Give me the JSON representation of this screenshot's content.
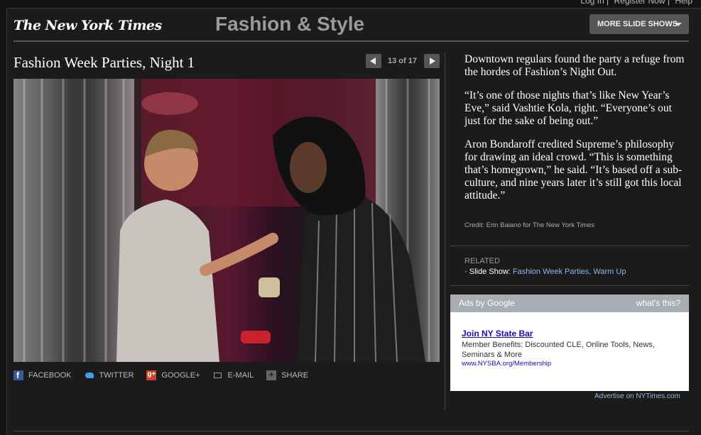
{
  "top_links": {
    "login": "Log In",
    "register": "Register Now",
    "help": "Help"
  },
  "header": {
    "logo": "The New York Times",
    "section": "Fashion & Style",
    "more_button": "MORE SLIDE SHOWS"
  },
  "slideshow": {
    "title": "Fashion Week Parties, Night 1",
    "counter": "13 of 17",
    "photo_alt": "Party guests talking at Fashion Week event"
  },
  "share": [
    {
      "label": "FACEBOOK",
      "icon": "facebook-icon"
    },
    {
      "label": "TWITTER",
      "icon": "twitter-icon"
    },
    {
      "label": "GOOGLE+",
      "icon": "google-plus-icon"
    },
    {
      "label": "E-MAIL",
      "icon": "email-icon"
    },
    {
      "label": "SHARE",
      "icon": "share-icon"
    }
  ],
  "caption": {
    "p1": "Downtown regulars found the party a refuge from the hordes of Fashion’s Night Out.",
    "p2": "“It’s one of those nights that’s like New Year’s Eve,” said Vashtie Kola, right. “Everyone’s out just for the sake of being out.”",
    "p3": "Aron Bondaroff credited Supreme’s philosophy for drawing an ideal crowd. “This is something that’s homegrown,” he said. “It’s based off a sub-culture, and nine years later it’s still got this local attitude.”",
    "credit": "Credit: Erin Baiano for The New York Times"
  },
  "related": {
    "label": "RELATED",
    "prefix": "Slide Show:",
    "link": "Fashion Week Parties, Warm Up"
  },
  "ad": {
    "header_left": "Ads by Google",
    "header_right": "what's this?",
    "title": "Join NY State Bar",
    "text": "Member Benefits: Discounted CLE, Online Tools, News, Seminars & More",
    "url": "www.NYSBA.org/Membership"
  },
  "advertise_link": "Advertise on NYTimes.com"
}
